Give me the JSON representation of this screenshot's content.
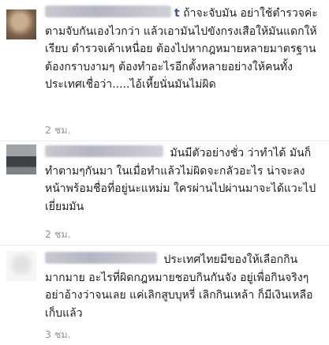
{
  "comments": [
    {
      "name_visible_tail": "t",
      "text": "ถ้าจะจับมัน อย่าใช้ตำรวจค่ะ ตามจับกันเองไวกว่า แล้วเอามันไปขังกรงเสือให้มันแดกให้เรียบ ตำรวจเค้าเหนื่อย ต้องไปหากฎหมายหลายมาตรฐาน ต้องกราบงามๆ ต้องทำอะไรอีกตั้งหลายอย่างให้คนทั้งประเทศเชื่อว่า.....ไอ้เหี้ยนั่นมันไม่ผิด",
      "time": "2 ชม.",
      "avatar_colors": [
        "#6e5a46",
        "#b59a7c"
      ]
    },
    {
      "name_visible_tail": "",
      "text": "มันมีตัวอย่างชั่ว ว่าทำได้ มันก็ทำตามๆกันมา ในเมื่อทำแล้วไม่ผิดจะกลัวอะไร น่าจะลงหน้าพร้อมชื่อที่อยู่นะแหม่ม ใครผ่านไปผ่านมาจะได้แวะไปเยี่ยมมัน",
      "time": "2 ชม.",
      "avatar_colors": [
        "#4a4e52",
        "#b9bcbf"
      ]
    },
    {
      "name_visible_tail": "",
      "text": "ประเทศไทยมีของให้เลือกกินมากมาย อะไรที่ผิดกฎหมายชอบกินกันจัง อยู่เพื่อกินจริงๆ อย่าอ้างว่าจนเลย แค่เลิกสูบบุหรี่ เลิกกินเหล้า ก็มีเงินเหลือเก็บแล้ว",
      "time": "3 ชม.",
      "avatar_colors": [
        "#e6e6e6",
        "#f4f4f4"
      ]
    }
  ]
}
